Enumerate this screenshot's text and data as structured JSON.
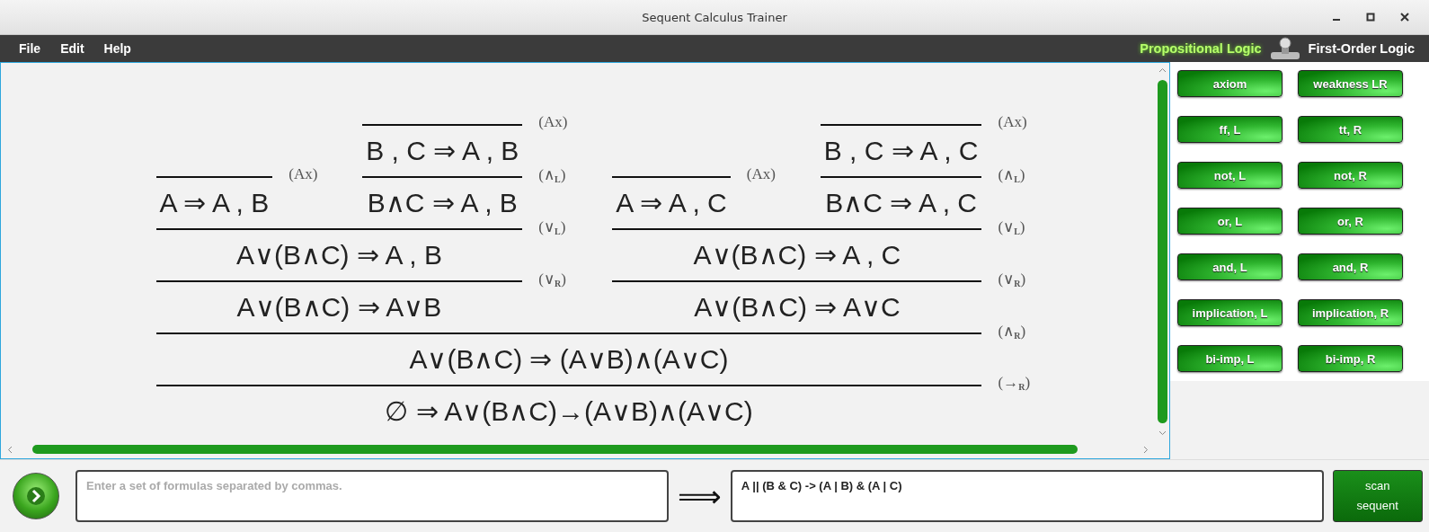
{
  "window": {
    "title": "Sequent Calculus Trainer"
  },
  "menu": [
    {
      "label": "File"
    },
    {
      "label": "Edit"
    },
    {
      "label": "Help"
    }
  ],
  "logic_modes": [
    {
      "label": "Propositional Logic",
      "selected": true
    },
    {
      "label": "First-Order Logic",
      "selected": false
    }
  ],
  "proof": {
    "conclusion": "∅ ⇒ A∨(B∧C)→(A∨B)∧(A∨C)",
    "rule": "(→$_{R}$)",
    "premises": [
      {
        "conclusion": "A∨(B∧C) ⇒ (A∨B)∧(A∨C)",
        "rule": "(∧$_{R}$)",
        "premises": [
          {
            "conclusion": "A∨(B∧C) ⇒ A∨B",
            "rule": "(∨$_{R}$)",
            "premises": [
              {
                "conclusion": "A∨(B∧C) ⇒ A , B",
                "rule": "(∨$_{L}$)",
                "premises": [
                  {
                    "conclusion": "A ⇒ A , B",
                    "rule": "(Ax)"
                  },
                  {
                    "conclusion": "B∧C ⇒ A , B",
                    "rule": "(∧$_{L}$)",
                    "premises": [
                      {
                        "conclusion": "B , C ⇒ A , B",
                        "rule": "(Ax)"
                      }
                    ]
                  }
                ]
              }
            ]
          },
          {
            "conclusion": "A∨(B∧C) ⇒ A∨C",
            "rule": "(∨$_{R}$)",
            "premises": [
              {
                "conclusion": "A∨(B∧C) ⇒ A , C",
                "rule": "(∨$_{L}$)",
                "premises": [
                  {
                    "conclusion": "A ⇒ A , C",
                    "rule": "(Ax)"
                  },
                  {
                    "conclusion": "B∧C ⇒ A , C",
                    "rule": "(∧$_{L}$)",
                    "premises": [
                      {
                        "conclusion": "B , C ⇒ A , C",
                        "rule": "(Ax)"
                      }
                    ]
                  }
                ]
              }
            ]
          }
        ]
      }
    ]
  },
  "rule_buttons": [
    {
      "label": "axiom"
    },
    {
      "label": "weakness LR"
    },
    {
      "label": "ff, L"
    },
    {
      "label": "tt, R"
    },
    {
      "label": "not, L"
    },
    {
      "label": "not, R"
    },
    {
      "label": "or, L"
    },
    {
      "label": "or, R"
    },
    {
      "label": "and, L"
    },
    {
      "label": "and, R"
    },
    {
      "label": "implication, L"
    },
    {
      "label": "implication, R"
    },
    {
      "label": "bi-imp, L"
    },
    {
      "label": "bi-imp, R"
    }
  ],
  "formula_input": {
    "placeholder": "Enter a set of formulas separated by commas."
  },
  "sequent_arrow": "⟹",
  "sequent_field": {
    "value": "A || (B & C) -> (A | B) & (A | C)"
  },
  "scan_button": {
    "label": "scan sequent"
  }
}
